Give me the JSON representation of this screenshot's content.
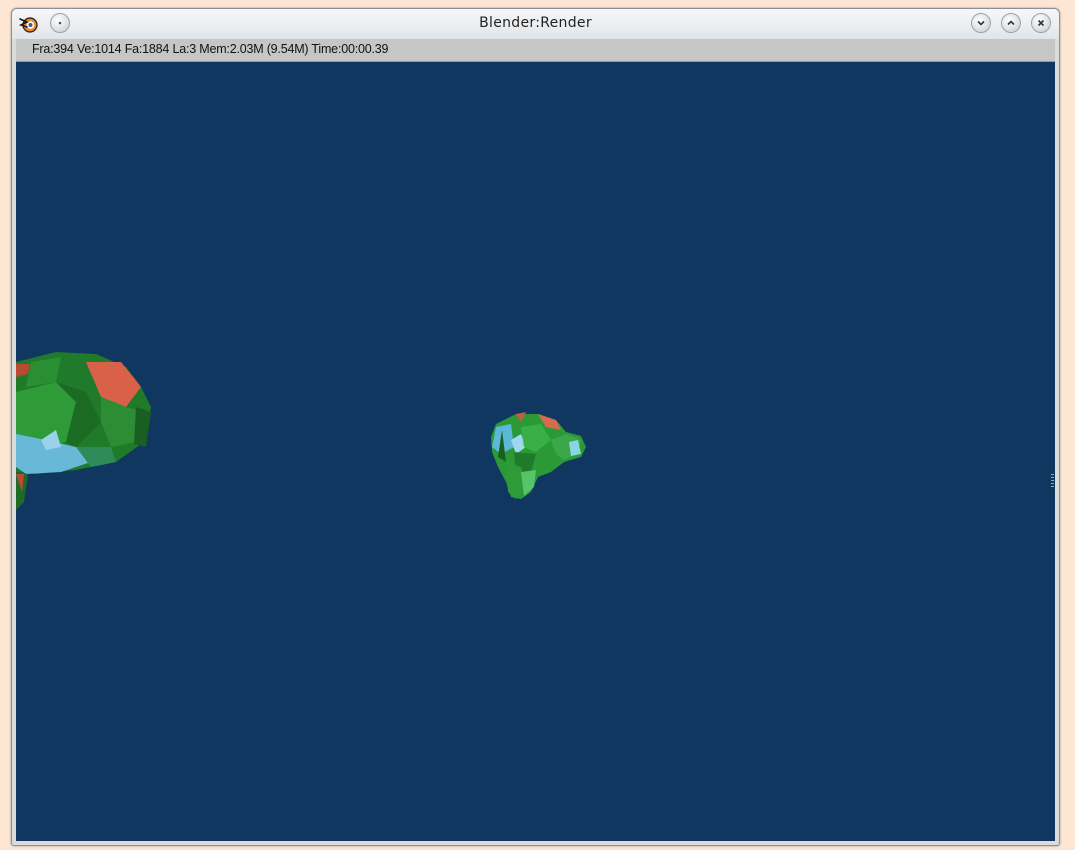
{
  "window": {
    "title": "Blender:Render",
    "icon": "blender-icon",
    "controls": [
      "menu-icon",
      "minimize-icon",
      "maximize-icon",
      "close-icon"
    ]
  },
  "statusbar": {
    "text": "Fra:394  Ve:1014 Fa:1884 La:3 Mem:2.03M (9.54M) Time:00:00.39"
  },
  "render": {
    "background_color": "#0f375f",
    "objects": [
      "suzanne-monkey-head-large",
      "suzanne-monkey-head-small"
    ]
  }
}
